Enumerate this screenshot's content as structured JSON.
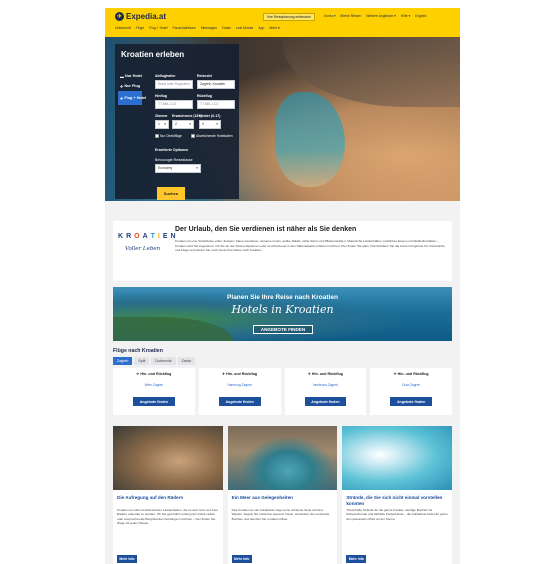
{
  "header": {
    "logo": "Expedia.at",
    "promo_button": "Ihre Reiseplanung entdecken",
    "top_links": [
      "Konto ▾",
      "Meine Reisen",
      "Weitere Angebote ▾",
      "Hilfe ▾",
      "English"
    ],
    "nav": [
      "Unterkunft",
      "Flüge",
      "Flug + Hotel",
      "Pauschalreisen",
      "Mietwagen",
      "Deals",
      "Last Minute",
      "App",
      "Mehr ▾"
    ]
  },
  "hero": {
    "title": "Kroatien erleben",
    "tabs": [
      {
        "icon": "bed-icon",
        "label": "Nur Hotel"
      },
      {
        "icon": "plane-icon",
        "label": "Nur Flug"
      },
      {
        "icon": "plane-icon",
        "label": "Flug + Hotel"
      }
    ],
    "departure_label": "Abflughafen",
    "departure_placeholder": "Stadt oder Flughafen",
    "destination_label": "Reiseziel",
    "destination_value": "Zagreb, Kroatien",
    "outbound_label": "Hinflug",
    "outbound_placeholder": "TT.MM.JJJJ",
    "return_label": "Rückflug",
    "return_placeholder": "TT.MM.JJJJ",
    "rooms_label": "Zimmer",
    "rooms_value": "1",
    "adults_label": "Erwachsene (18+)",
    "adults_value": "2",
    "children_label": "Kinder (0-17)",
    "children_value": "0",
    "check_nonstop": "Nur Direktflüge",
    "check_dates": "Abweichende Hoteldaten",
    "advanced_label": "Erweiterte Optionen",
    "class_label": "Bevorzugte Reiseklasse",
    "class_value": "Economy",
    "search_button": "Suchen"
  },
  "intro": {
    "logo_letters": [
      "K",
      "R",
      "O",
      "A",
      "T",
      "I",
      "E",
      "N"
    ],
    "logo_colors": [
      "#1e3e7a",
      "#1e3e7a",
      "#e14b2a",
      "#1e3e7a",
      "#2f9ad8",
      "#f2b21f",
      "#1e3e7a",
      "#1e3e7a"
    ],
    "logo_tagline": "Voller Leben",
    "title": "Der Urlaub, den Sie verdienen ist näher als Sie denken",
    "text": "Kroatien ist eine Schatzkiste voller Juwelen: blaue Gewässer, einsame Inseln, antike Städte, wilde Natur und Pflästerstraßen. Malerische Landschaften, köstliches Essen und Weltkulturstätten – Kroatien wird Sie begeistern. Ob Sie an der Adria entspannen oder ein Abenteuer in den Nationalparks erleben möchten: Hier finden Sie alles. Durchstöbern Sie die besten Angebote für Unterkünfte und Flüge und planen Sie noch heute Ihre Reise nach Kroatien."
  },
  "banner": {
    "title": "Planen Sie Ihre Reise nach Kroatien",
    "subtitle": "Hotels in Kroatien",
    "button": "ANGEBOTE FINDEN"
  },
  "flights": {
    "title": "Flüge nach Kroatien",
    "tabs": [
      "Zagreb",
      "Split",
      "Dubrovnik",
      "Zadar"
    ],
    "active_tab": 0,
    "cards": [
      {
        "type": "Hin- und Rückflug",
        "route": "Wien-Zagreb",
        "button": "Angebote finden"
      },
      {
        "type": "Hin- und Rückflug",
        "route": "Hamburg-Zagreb",
        "button": "Angebote finden"
      },
      {
        "type": "Hin- und Rückflug",
        "route": "Innsbruck-Zagreb",
        "button": "Angebote finden"
      },
      {
        "type": "Hin- und Rückflug",
        "route": "Graz-Zagreb",
        "button": "Angebote finden"
      }
    ]
  },
  "articles": [
    {
      "title": "Die Aufregung auf den Rädern",
      "text": "Kroatien ist voller kontrastreicher Landschaften, die es wert sind, auf zwei Rädern erkundet zu werden. Ob Sie gemütlich entlang der Küste radeln oder anspruchsvolle Bergstrecken bezwingen möchten – hier finden Sie Wege für jedes Niveau.",
      "button": "Mehr Info"
    },
    {
      "title": "Ein Meer aus Gelegenheiten",
      "text": "Das Kroatien an der Adriaküste zeigt seine schönste Seite auf dem Wasser. Segeln Sie zwischen tausend Inseln, entdecken Sie versteckte Buchten und tauchen Sie in klarem Meer.",
      "button": "Mehr Info"
    },
    {
      "title": "Strände, die Sie sich nicht einmal vorstellen konnten",
      "text": "Traumhafte Strände für die ganze Familie, sandige Buchten für Ruhesuchende und lebhafte Partystrände – die Adriaküste bietet für jeden den passenden Platz an der Sonne.",
      "button": "Mehr Info"
    }
  ]
}
